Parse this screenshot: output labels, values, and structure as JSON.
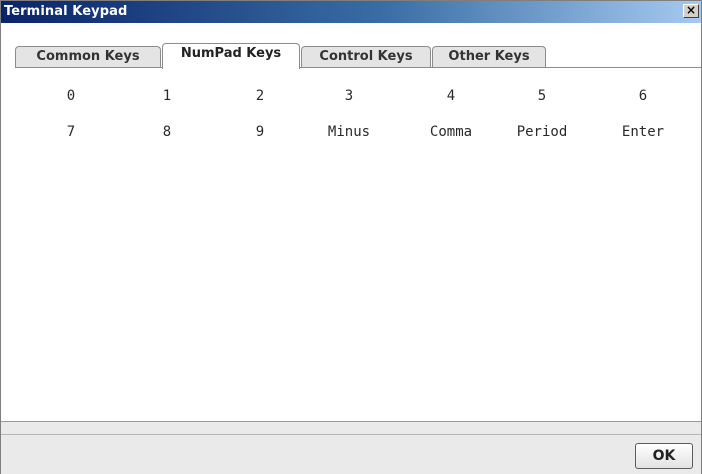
{
  "window": {
    "title": "Terminal Keypad",
    "close_symbol": "×"
  },
  "tabs": [
    {
      "label": "Common Keys",
      "active": false
    },
    {
      "label": "NumPad Keys",
      "active": true
    },
    {
      "label": "Control Keys",
      "active": false
    },
    {
      "label": "Other Keys",
      "active": false
    }
  ],
  "keys": {
    "row1": [
      "0",
      "1",
      "2",
      "3",
      "4",
      "5",
      "6"
    ],
    "row2": [
      "7",
      "8",
      "9",
      "Minus",
      "Comma",
      "Period",
      "Enter"
    ]
  },
  "footer": {
    "ok_label": "OK"
  },
  "colors": {
    "titlebar_start": "#0a246a",
    "titlebar_end": "#a6caf0",
    "footer_bg": "#eaeaea"
  }
}
